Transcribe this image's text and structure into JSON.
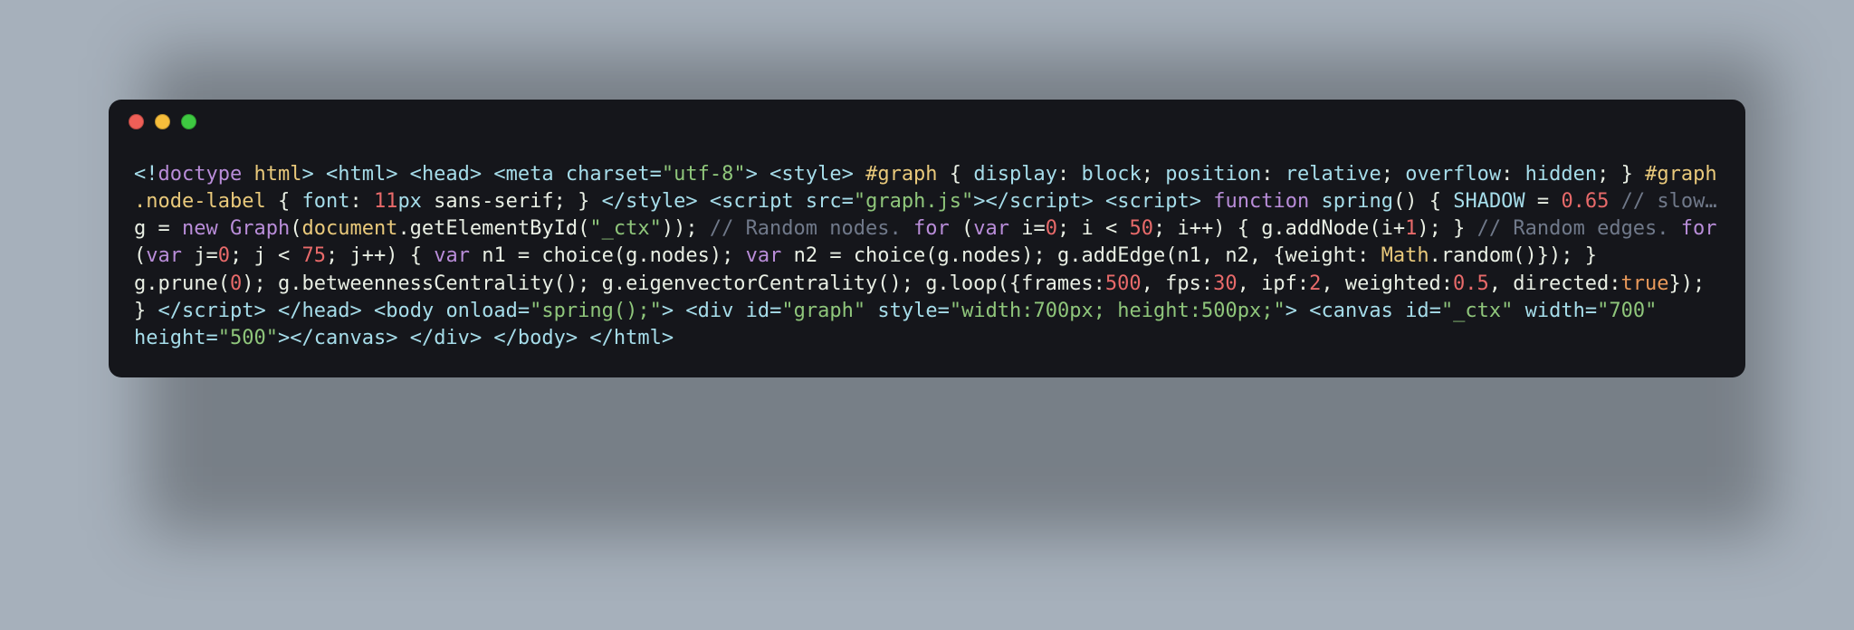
{
  "colors": {
    "page_bg": "#a6b0bb",
    "window_bg": "#15161b",
    "dot_red": "#ef5f57",
    "dot_yellow": "#f6bd3b",
    "dot_green": "#3ec941",
    "syntax_default": "#a6ddea",
    "syntax_white": "#e9efe4",
    "syntax_string": "#8fc67b",
    "syntax_keyword": "#b98dd9",
    "syntax_number": "#e86a6a",
    "syntax_comment": "#70798a",
    "syntax_yellow": "#e9c97b",
    "syntax_orange": "#ea9a5b"
  },
  "traffic_lights": [
    "close",
    "minimize",
    "zoom"
  ],
  "code_tokens": [
    {
      "t": "<!",
      "c": "default"
    },
    {
      "t": "doctype",
      "c": "keyword"
    },
    {
      "t": " ",
      "c": "default"
    },
    {
      "t": "html",
      "c": "yellow"
    },
    {
      "t": "> <",
      "c": "default"
    },
    {
      "t": "html",
      "c": "default"
    },
    {
      "t": "> <",
      "c": "default"
    },
    {
      "t": "head",
      "c": "default"
    },
    {
      "t": "> <",
      "c": "default"
    },
    {
      "t": "meta",
      "c": "default"
    },
    {
      "t": " ",
      "c": "default"
    },
    {
      "t": "charset",
      "c": "default"
    },
    {
      "t": "=",
      "c": "default"
    },
    {
      "t": "\"utf-8\"",
      "c": "string"
    },
    {
      "t": "> <",
      "c": "default"
    },
    {
      "t": "style",
      "c": "default"
    },
    {
      "t": "> ",
      "c": "default"
    },
    {
      "t": "#graph",
      "c": "yellow"
    },
    {
      "t": " { ",
      "c": "white"
    },
    {
      "t": "display",
      "c": "default"
    },
    {
      "t": ": ",
      "c": "white"
    },
    {
      "t": "block",
      "c": "default"
    },
    {
      "t": "; ",
      "c": "white"
    },
    {
      "t": "position",
      "c": "default"
    },
    {
      "t": ": ",
      "c": "white"
    },
    {
      "t": "relative",
      "c": "default"
    },
    {
      "t": "; ",
      "c": "white"
    },
    {
      "t": "overflow",
      "c": "default"
    },
    {
      "t": ": ",
      "c": "white"
    },
    {
      "t": "hidden",
      "c": "default"
    },
    {
      "t": "; } ",
      "c": "white"
    },
    {
      "t": "#graph",
      "c": "yellow"
    },
    {
      "t": " ",
      "c": "white"
    },
    {
      "t": ".node-label",
      "c": "yellow"
    },
    {
      "t": " { ",
      "c": "white"
    },
    {
      "t": "font",
      "c": "default"
    },
    {
      "t": ": ",
      "c": "white"
    },
    {
      "t": "11",
      "c": "number"
    },
    {
      "t": "px",
      "c": "default"
    },
    {
      "t": " sans-serif; } ",
      "c": "white"
    },
    {
      "t": "</",
      "c": "default"
    },
    {
      "t": "style",
      "c": "default"
    },
    {
      "t": "> <",
      "c": "default"
    },
    {
      "t": "script",
      "c": "default"
    },
    {
      "t": " ",
      "c": "default"
    },
    {
      "t": "src",
      "c": "default"
    },
    {
      "t": "=",
      "c": "default"
    },
    {
      "t": "\"graph.js\"",
      "c": "string"
    },
    {
      "t": ">",
      "c": "default"
    },
    {
      "t": "</",
      "c": "default"
    },
    {
      "t": "script",
      "c": "default"
    },
    {
      "t": "> <",
      "c": "default"
    },
    {
      "t": "script",
      "c": "default"
    },
    {
      "t": "> ",
      "c": "default"
    },
    {
      "t": "function",
      "c": "keyword"
    },
    {
      "t": " ",
      "c": "white"
    },
    {
      "t": "spring",
      "c": "default"
    },
    {
      "t": "() { ",
      "c": "white"
    },
    {
      "t": "SHADOW",
      "c": "default"
    },
    {
      "t": " = ",
      "c": "white"
    },
    {
      "t": "0.65",
      "c": "number"
    },
    {
      "t": " ",
      "c": "white"
    },
    {
      "t": "// slow…",
      "c": "comment"
    },
    {
      "t": " g = ",
      "c": "white"
    },
    {
      "t": "new",
      "c": "keyword"
    },
    {
      "t": " ",
      "c": "white"
    },
    {
      "t": "Graph",
      "c": "keyword"
    },
    {
      "t": "(",
      "c": "white"
    },
    {
      "t": "document",
      "c": "yellow"
    },
    {
      "t": ".getElementById(",
      "c": "white"
    },
    {
      "t": "\"_ctx\"",
      "c": "string"
    },
    {
      "t": ")); ",
      "c": "white"
    },
    {
      "t": "// Random nodes.",
      "c": "comment"
    },
    {
      "t": " ",
      "c": "white"
    },
    {
      "t": "for",
      "c": "keyword"
    },
    {
      "t": " (",
      "c": "white"
    },
    {
      "t": "var",
      "c": "keyword"
    },
    {
      "t": " i=",
      "c": "white"
    },
    {
      "t": "0",
      "c": "number"
    },
    {
      "t": "; i < ",
      "c": "white"
    },
    {
      "t": "50",
      "c": "number"
    },
    {
      "t": "; i++) { g.addNode(i+",
      "c": "white"
    },
    {
      "t": "1",
      "c": "number"
    },
    {
      "t": "); } ",
      "c": "white"
    },
    {
      "t": "// Random edges.",
      "c": "comment"
    },
    {
      "t": " ",
      "c": "white"
    },
    {
      "t": "for",
      "c": "keyword"
    },
    {
      "t": " (",
      "c": "white"
    },
    {
      "t": "var",
      "c": "keyword"
    },
    {
      "t": " j=",
      "c": "white"
    },
    {
      "t": "0",
      "c": "number"
    },
    {
      "t": "; j < ",
      "c": "white"
    },
    {
      "t": "75",
      "c": "number"
    },
    {
      "t": "; j++) { ",
      "c": "white"
    },
    {
      "t": "var",
      "c": "keyword"
    },
    {
      "t": " n1 = choice(g.nodes); ",
      "c": "white"
    },
    {
      "t": "var",
      "c": "keyword"
    },
    {
      "t": " n2 = choice(g.nodes); g.addEdge(n1, n2, {weight: ",
      "c": "white"
    },
    {
      "t": "Math",
      "c": "yellow"
    },
    {
      "t": ".random()}); } g.prune(",
      "c": "white"
    },
    {
      "t": "0",
      "c": "number"
    },
    {
      "t": "); g.betweennessCentrality(); g.eigenvectorCentrality(); g.loop({frames:",
      "c": "white"
    },
    {
      "t": "500",
      "c": "number"
    },
    {
      "t": ", fps:",
      "c": "white"
    },
    {
      "t": "30",
      "c": "number"
    },
    {
      "t": ", ipf:",
      "c": "white"
    },
    {
      "t": "2",
      "c": "number"
    },
    {
      "t": ", weighted:",
      "c": "white"
    },
    {
      "t": "0.5",
      "c": "number"
    },
    {
      "t": ", directed:",
      "c": "white"
    },
    {
      "t": "true",
      "c": "orange"
    },
    {
      "t": "}); } ",
      "c": "white"
    },
    {
      "t": "</",
      "c": "default"
    },
    {
      "t": "script",
      "c": "default"
    },
    {
      "t": "> </",
      "c": "default"
    },
    {
      "t": "head",
      "c": "default"
    },
    {
      "t": "> <",
      "c": "default"
    },
    {
      "t": "body",
      "c": "default"
    },
    {
      "t": " ",
      "c": "default"
    },
    {
      "t": "onload",
      "c": "default"
    },
    {
      "t": "=",
      "c": "default"
    },
    {
      "t": "\"spring();\"",
      "c": "string"
    },
    {
      "t": "> <",
      "c": "default"
    },
    {
      "t": "div",
      "c": "default"
    },
    {
      "t": " ",
      "c": "default"
    },
    {
      "t": "id",
      "c": "default"
    },
    {
      "t": "=",
      "c": "default"
    },
    {
      "t": "\"graph\"",
      "c": "string"
    },
    {
      "t": " ",
      "c": "default"
    },
    {
      "t": "style",
      "c": "default"
    },
    {
      "t": "=",
      "c": "default"
    },
    {
      "t": "\"width:700px; height:500px;\"",
      "c": "string"
    },
    {
      "t": "> <",
      "c": "default"
    },
    {
      "t": "canvas",
      "c": "default"
    },
    {
      "t": " ",
      "c": "default"
    },
    {
      "t": "id",
      "c": "default"
    },
    {
      "t": "=",
      "c": "default"
    },
    {
      "t": "\"_ctx\"",
      "c": "string"
    },
    {
      "t": " ",
      "c": "default"
    },
    {
      "t": "width",
      "c": "default"
    },
    {
      "t": "=",
      "c": "default"
    },
    {
      "t": "\"700\"",
      "c": "string"
    },
    {
      "t": " ",
      "c": "default"
    },
    {
      "t": "height",
      "c": "default"
    },
    {
      "t": "=",
      "c": "default"
    },
    {
      "t": "\"500\"",
      "c": "string"
    },
    {
      "t": ">",
      "c": "default"
    },
    {
      "t": "</",
      "c": "default"
    },
    {
      "t": "canvas",
      "c": "default"
    },
    {
      "t": "> </",
      "c": "default"
    },
    {
      "t": "div",
      "c": "default"
    },
    {
      "t": "> </",
      "c": "default"
    },
    {
      "t": "body",
      "c": "default"
    },
    {
      "t": "> </",
      "c": "default"
    },
    {
      "t": "html",
      "c": "default"
    },
    {
      "t": ">",
      "c": "default"
    }
  ]
}
